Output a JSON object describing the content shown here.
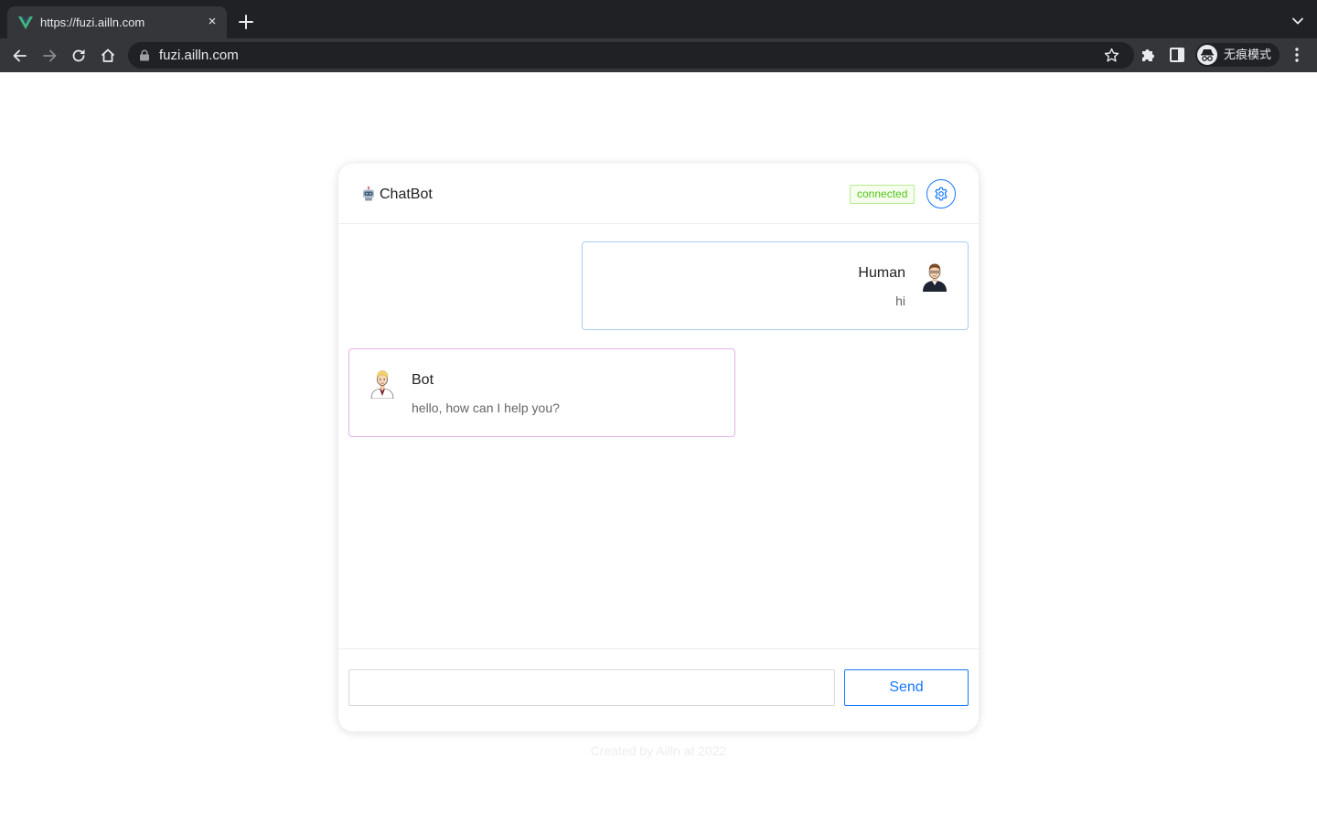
{
  "browser": {
    "tab": {
      "title": "https://fuzi.ailln.com",
      "close_glyph": "×",
      "favicon": "vue-logo-icon"
    },
    "address_bar": {
      "url": "fuzi.ailln.com"
    },
    "profile": {
      "label": "无痕模式",
      "icon": "incognito-icon"
    },
    "colors": {
      "tabbar": "#202124",
      "toolbar": "#35363a",
      "text": "#e8eaed",
      "vue_green": "#41b883"
    }
  },
  "app": {
    "title": "ChatBot",
    "title_icon": "robot-icon",
    "status": "connected",
    "settings_icon": "gear-icon"
  },
  "messages": [
    {
      "role": "human",
      "name": "Human",
      "text": "hi",
      "avatar": "human-avatar",
      "border_color": "#a9ccf2"
    },
    {
      "role": "bot",
      "name": "Bot",
      "text": "hello, how can I help you?",
      "avatar": "bot-avatar",
      "border_color": "#e3b1e8"
    }
  ],
  "composer": {
    "input_value": "",
    "send_label": "Send"
  },
  "footer": {
    "text": "Created by Ailln at 2022"
  },
  "colors": {
    "accent": "#1677ff",
    "status_green": "#52c41a",
    "status_bg": "#f6ffed",
    "status_border": "#b7eb8f"
  }
}
